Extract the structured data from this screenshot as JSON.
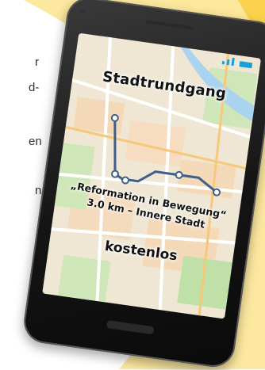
{
  "left_text_fragments": [
    "r",
    "d-",
    "en",
    "n"
  ],
  "phone": {
    "screen": {
      "title": "Stadtrundgang",
      "subtitle_line1": "„Reformation in Bewegung“",
      "subtitle_line2": "3.0 km – Innere Stadt",
      "price": "kostenlos"
    }
  },
  "colors": {
    "background_yellow": "#fde79a",
    "route_blue": "#3f5f8a",
    "signal_blue": "#1aa0d8",
    "phone_body": "#151515"
  }
}
